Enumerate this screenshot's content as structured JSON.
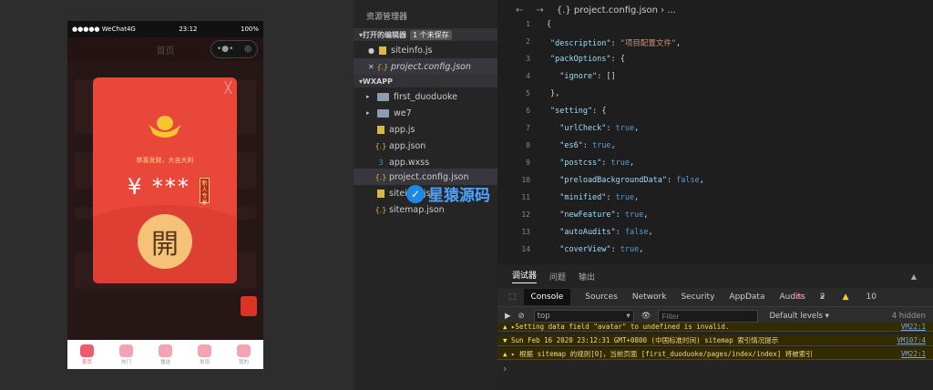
{
  "simulator": {
    "status_carrier": "●●●●● WeChat4G",
    "status_time": "23:12",
    "status_battery": "100%",
    "nav_title": "首页",
    "capsule_more": "•●•",
    "capsule_close": "◎",
    "redpacket": {
      "close": "╳",
      "greeting": "恭喜发财，大吉大利",
      "amount": "¥ ***",
      "badge": "新人专享",
      "open_label": "開"
    },
    "tabs": [
      {
        "label": "首页",
        "active": true
      },
      {
        "label": "热门",
        "active": false
      },
      {
        "label": "播选",
        "active": false
      },
      {
        "label": "发现",
        "active": false
      },
      {
        "label": "我的",
        "active": false
      }
    ]
  },
  "explorer": {
    "title": "资源管理器",
    "open_editors_label": "打开的编辑器",
    "unsaved_tag": "1 个未保存",
    "open_files": [
      {
        "name": "siteinfo.js",
        "marker": "●"
      },
      {
        "name": "project.config.json",
        "marker": "✕"
      }
    ],
    "project_label": "WXAPP",
    "tree": [
      {
        "name": "first_duoduoke"
      },
      {
        "name": "we7"
      },
      {
        "name": "app.js"
      },
      {
        "name": "app.json"
      },
      {
        "name": "app.wxss"
      },
      {
        "name": "project.config.json"
      },
      {
        "name": "siteinfo.js"
      },
      {
        "name": "sitemap.json"
      }
    ]
  },
  "watermark": {
    "text": "星猿源码",
    "icon": "✓"
  },
  "editor": {
    "breadcrumb": "{.} project.config.json › ...",
    "lines": [
      {
        "n": "1",
        "text": "{"
      },
      {
        "n": "2",
        "key": "\"description\"",
        "val": "\"项目配置文件\"",
        "tail": ","
      },
      {
        "n": "3",
        "key": "\"packOptions\"",
        "val": "{",
        "tail": ""
      },
      {
        "n": "4",
        "key": "  \"ignore\"",
        "val": "[]",
        "tail": ""
      },
      {
        "n": "5",
        "text": "},"
      },
      {
        "n": "6",
        "key": "\"setting\"",
        "val": "{",
        "tail": ""
      },
      {
        "n": "7",
        "key": "  \"urlCheck\"",
        "val": "true",
        "tail": ","
      },
      {
        "n": "8",
        "key": "  \"es6\"",
        "val": "true",
        "tail": ","
      },
      {
        "n": "9",
        "key": "  \"postcss\"",
        "val": "true",
        "tail": ","
      },
      {
        "n": "10",
        "key": "  \"preloadBackgroundData\"",
        "val": "false",
        "tail": ","
      },
      {
        "n": "11",
        "key": "  \"minified\"",
        "val": "true",
        "tail": ","
      },
      {
        "n": "12",
        "key": "  \"newFeature\"",
        "val": "true",
        "tail": ","
      },
      {
        "n": "13",
        "key": "  \"autoAudits\"",
        "val": "false",
        "tail": ","
      },
      {
        "n": "14",
        "key": "  \"coverView\"",
        "val": "true",
        "tail": ","
      }
    ]
  },
  "console": {
    "panel_tabs": [
      "调试器",
      "问题",
      "输出"
    ],
    "dev_tabs": [
      "Console",
      "Sources",
      "Network",
      "Security",
      "AppData",
      "Audits"
    ],
    "more": "»",
    "errors": "2",
    "warnings": "10",
    "context": "top",
    "filter_placeholder": "Filter",
    "levels": "Default levels ▾",
    "hidden": "4 hidden",
    "logs": [
      {
        "text": "▲ ▸Setting data field \"avatar\" to undefined is invalid.",
        "src": "VM22:1"
      },
      {
        "text": "▼ Sun Feb 16 2020 23:12:31 GMT+0800 (中国标准时间) sitemap 索引情况提示",
        "src": "VM107:4"
      },
      {
        "text": "  ▲ ▸ 根据 sitemap 的规则[0]，当前页面 [first_duoduoke/pages/index/index] 将被索引",
        "src": "VM22:1"
      }
    ],
    "prompt": "›"
  }
}
